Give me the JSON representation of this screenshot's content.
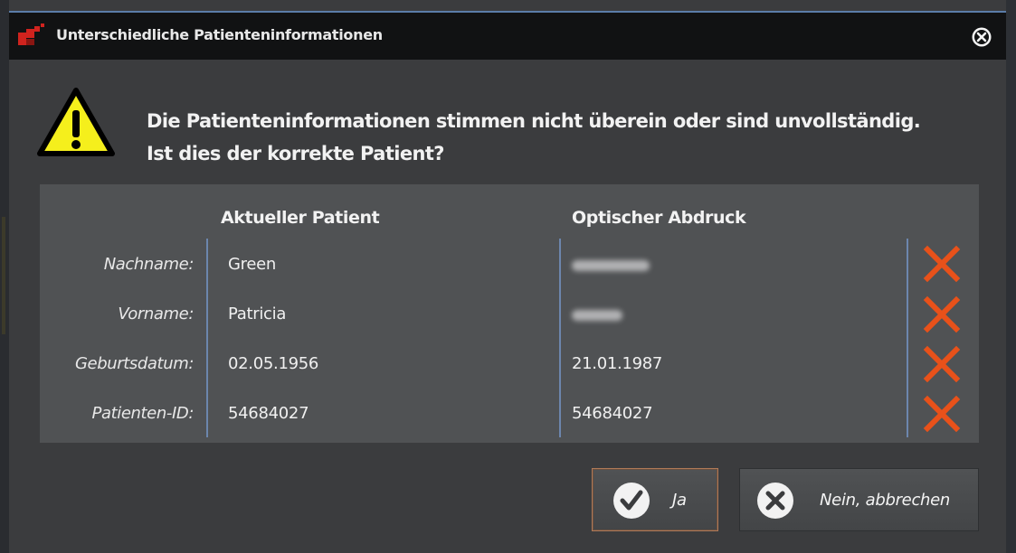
{
  "window": {
    "title": "Unterschiedliche Patienteninformationen",
    "close_icon": "close-circle-icon"
  },
  "message": {
    "line1": "Die Patienteninformationen stimmen nicht überein oder sind unvollständig.",
    "line2": "Ist dies der korrekte Patient?",
    "icon": "warning-triangle-icon"
  },
  "table": {
    "columns": [
      "Aktueller Patient",
      "Optischer Abdruck"
    ],
    "rows": [
      {
        "label": "Nachname:",
        "current": "Green",
        "optical": "",
        "optical_blurred": true,
        "mismatch_icon": "x-mark-icon"
      },
      {
        "label": "Vorname:",
        "current": "Patricia",
        "optical": "",
        "optical_blurred": true,
        "mismatch_icon": "x-mark-icon"
      },
      {
        "label": "Geburtsdatum:",
        "current": "02.05.1956",
        "optical": "21.01.1987",
        "optical_blurred": false,
        "mismatch_icon": "x-mark-icon"
      },
      {
        "label": "Patienten-ID:",
        "current": "54684027",
        "optical": "54684027",
        "optical_blurred": false,
        "mismatch_icon": "x-mark-icon"
      }
    ]
  },
  "buttons": {
    "yes": {
      "label": "Ja",
      "icon": "checkmark-circle-icon"
    },
    "no": {
      "label": "Nein, abbrechen",
      "icon": "cross-circle-icon"
    }
  },
  "colors": {
    "accent_red": "#d0231e",
    "mismatch_orange": "#e8511a",
    "warning_yellow": "#f5ef1c",
    "dialog_bg": "#3b3c3e",
    "panel_bg": "#505254",
    "divider": "#6c86ad"
  }
}
